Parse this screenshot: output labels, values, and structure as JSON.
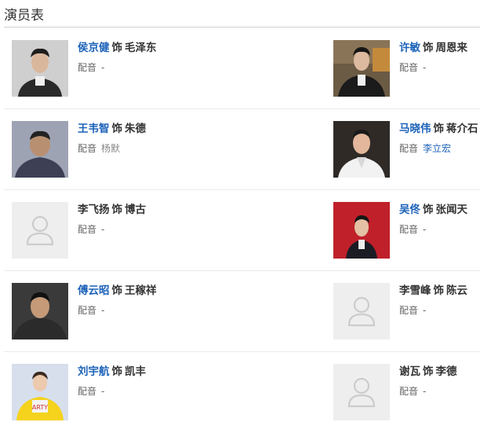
{
  "section": {
    "title": "演员表"
  },
  "labels": {
    "shi": "饰",
    "dub": "配音"
  },
  "cast": [
    {
      "actor": "侯京健",
      "role": "毛泽东",
      "dub": "-",
      "actor_link": true,
      "dub_link": false,
      "photo": "man-suit"
    },
    {
      "actor": "许敏",
      "role": "周恩来",
      "dub": "-",
      "actor_link": true,
      "dub_link": false,
      "photo": "man-street"
    },
    {
      "actor": "王韦智",
      "role": "朱德",
      "dub": "杨默",
      "actor_link": true,
      "dub_link": false,
      "photo": "man-gray"
    },
    {
      "actor": "马晓伟",
      "role": "蒋介石",
      "dub": "李立宏",
      "actor_link": true,
      "dub_link": true,
      "photo": "man-white-shirt"
    },
    {
      "actor": "李飞扬",
      "role": "博古",
      "dub": "-",
      "actor_link": false,
      "dub_link": false,
      "photo": "placeholder"
    },
    {
      "actor": "吴佟",
      "role": "张闻天",
      "dub": "-",
      "actor_link": true,
      "dub_link": false,
      "photo": "man-red-bg"
    },
    {
      "actor": "傅云昭",
      "role": "王稼祥",
      "dub": "-",
      "actor_link": true,
      "dub_link": false,
      "photo": "man-dark"
    },
    {
      "actor": "李雪峰",
      "role": "陈云",
      "dub": "-",
      "actor_link": false,
      "dub_link": false,
      "photo": "placeholder"
    },
    {
      "actor": "刘宇航",
      "role": "凯丰",
      "dub": "-",
      "actor_link": true,
      "dub_link": false,
      "photo": "man-yellow"
    },
    {
      "actor": "谢瓦",
      "role": "李德",
      "dub": "-",
      "actor_link": false,
      "dub_link": false,
      "photo": "placeholder"
    }
  ]
}
